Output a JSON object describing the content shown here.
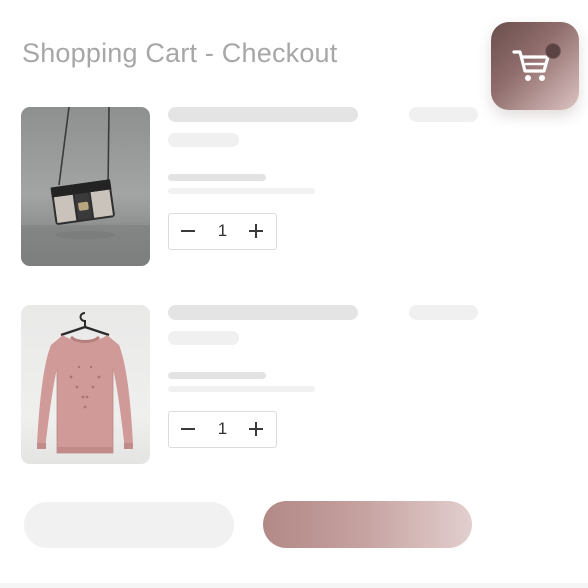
{
  "header": {
    "title": "Shopping Cart - Checkout",
    "cart_icon": "shopping-cart-icon"
  },
  "items": [
    {
      "image": "crossbody-bag-photo",
      "quantity": "1",
      "decrement_icon": "minus-icon",
      "increment_icon": "plus-icon"
    },
    {
      "image": "pink-sweater-photo",
      "quantity": "1",
      "decrement_icon": "minus-icon",
      "increment_icon": "plus-icon"
    }
  ],
  "colors": {
    "accent": "#b28987",
    "accent_dark": "#6a4e4d",
    "skeleton": "#e6e6e6",
    "title_text": "#a7a7a7"
  }
}
